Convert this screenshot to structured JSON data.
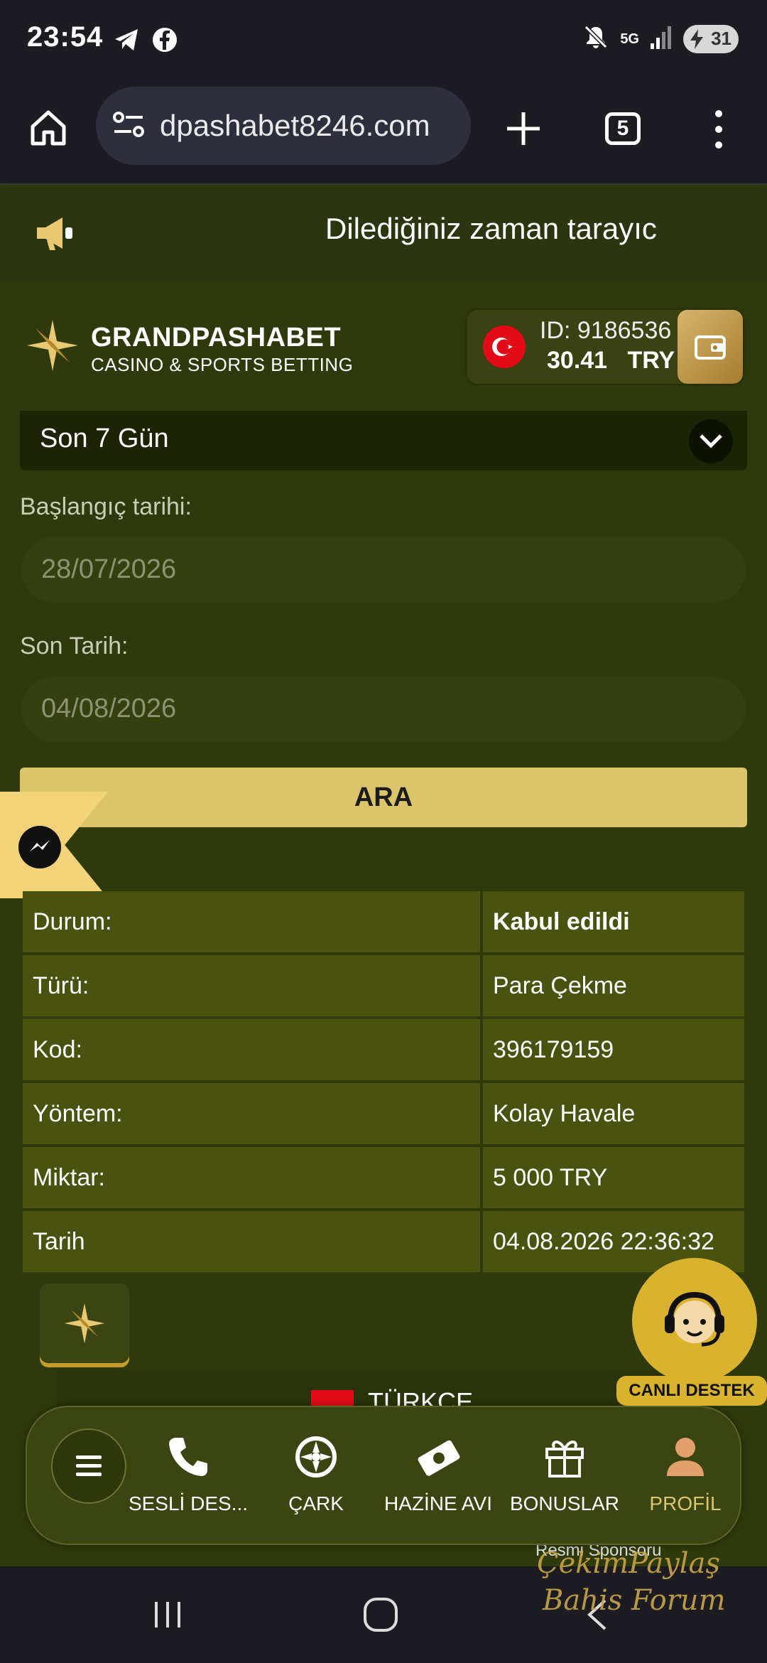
{
  "status_bar": {
    "time": "23:54",
    "battery": "31",
    "network": "5G",
    "icons": [
      "telegram-icon",
      "facebook-icon",
      "mute-icon",
      "signal-icon",
      "battery-icon"
    ]
  },
  "browser": {
    "url": "dpashabet8246.com",
    "tab_count": "5"
  },
  "announcement": {
    "text": "Dilediğiniz zaman tarayıc"
  },
  "header": {
    "brand": "GRANDPASHABET",
    "tagline": "CASINO & SPORTS BETTING",
    "user_id": "ID: 9186536",
    "balance": "30.41",
    "currency": "TRY"
  },
  "filter": {
    "period": "Son 7 Gün",
    "start_label": "Başlangıç tarihi:",
    "start_value": "28/07/2026",
    "end_label": "Son Tarih:",
    "end_value": "04/08/2026",
    "search_label": "ARA"
  },
  "details": [
    {
      "key": "Durum:",
      "value": "Kabul edildi"
    },
    {
      "key": "Türü:",
      "value": "Para Çekme"
    },
    {
      "key": "Kod:",
      "value": "396179159"
    },
    {
      "key": "Yöntem:",
      "value": "Kolay Havale"
    },
    {
      "key": "Miktar:",
      "value": "5 000 TRY"
    },
    {
      "key": "Tarih",
      "value": "04.08.2026 22:36:32"
    }
  ],
  "footer": {
    "language": "TÜRKÇE",
    "support_label": "CANLI DESTEK",
    "sponsor_text": "Resmi Sponsoru"
  },
  "bottom_nav": [
    {
      "label": "SESLİ DES...",
      "icon": "phone-icon"
    },
    {
      "label": "ÇARK",
      "icon": "wheel-icon"
    },
    {
      "label": "HAZİNE AVI",
      "icon": "money-icon"
    },
    {
      "label": "BONUSLAR",
      "icon": "gift-icon"
    },
    {
      "label": "PROFİL",
      "icon": "profile-icon"
    }
  ],
  "watermark": {
    "line1": "ÇekimPaylaş",
    "line2": "Bahis Forum"
  },
  "colors": {
    "page_bg": "#2f3a0c",
    "accent_gold": "#dcc46a",
    "cell_bg": "#49530f"
  }
}
